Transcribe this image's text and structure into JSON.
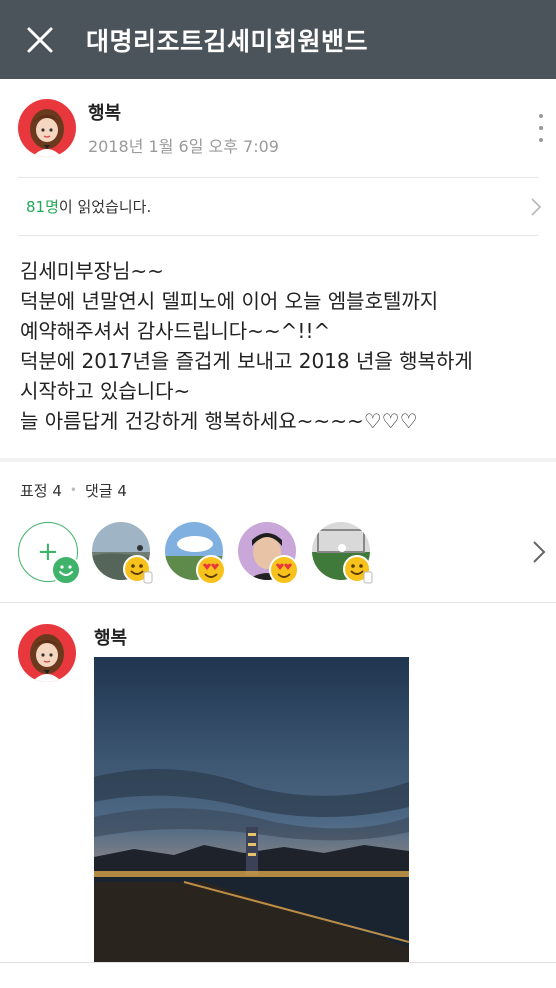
{
  "header": {
    "title": "대명리조트김세미회원밴드",
    "close_icon": "close-icon"
  },
  "post": {
    "author": "행복",
    "time": "2018년 1월 6일 오후 7:09",
    "readers_count": "81명",
    "readers_text": "이 읽었습니다.",
    "body_lines": [
      "김세미부장님~~",
      "덕분에 년말연시 델피노에 이어 오늘 엠블호텔까지",
      "예약해주셔서 감사드립니다~~^!!^",
      "덕분에 2017년을 즐겁게 보내고 2018 년을 행복하게",
      "시작하고 있습니다~",
      "늘 아름답게 건강하게 행복하세요~~~~♡♡♡"
    ]
  },
  "stats": {
    "reactions": "표정 4",
    "separator": "•",
    "comments": "댓글 4"
  },
  "reactions": [
    {
      "name": "reaction-1",
      "emoji": "thumbs-up-smile"
    },
    {
      "name": "reaction-2",
      "emoji": "heart-eyes"
    },
    {
      "name": "reaction-3",
      "emoji": "heart-eyes"
    },
    {
      "name": "reaction-4",
      "emoji": "thumbs-up-smile"
    }
  ],
  "comment": {
    "author": "행복"
  },
  "colors": {
    "header": "#4b535b",
    "accent_green": "#25a859",
    "emoji_yellow": "#f7c21c"
  }
}
